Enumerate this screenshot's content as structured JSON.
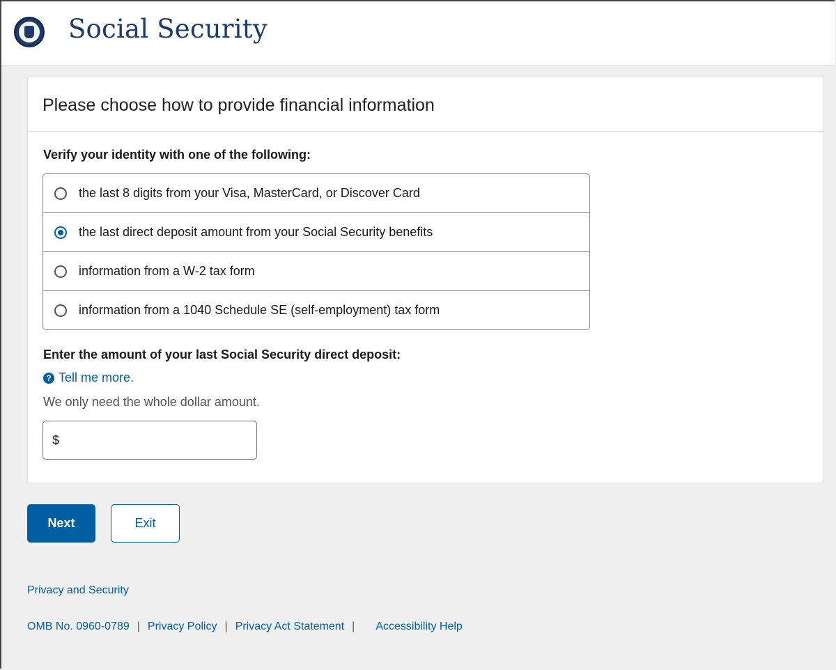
{
  "header": {
    "brand": "Social Security"
  },
  "card": {
    "title": "Please choose how to provide financial information",
    "verify_label": "Verify your identity with one of the following:",
    "options": [
      {
        "label": "the last 8 digits from your Visa, MasterCard, or Discover Card",
        "checked": false
      },
      {
        "label": "the last direct deposit amount from your Social Security benefits",
        "checked": true
      },
      {
        "label": "information from a W-2 tax form",
        "checked": false
      },
      {
        "label": "information from a 1040 Schedule SE (self-employment) tax form",
        "checked": false
      }
    ],
    "amount_label": "Enter the amount of your last Social Security direct deposit:",
    "tell_more": "Tell me more.",
    "hint": "We only need the whole dollar amount.",
    "amount_prefix": "$",
    "amount_value": ""
  },
  "buttons": {
    "next": "Next",
    "exit": "Exit"
  },
  "footer": {
    "privacy_security": "Privacy and Security",
    "omb": "OMB No. 0960-0789",
    "privacy_policy": "Privacy Policy",
    "privacy_act": "Privacy Act Statement",
    "accessibility": "Accessibility Help",
    "separator": "|"
  },
  "colors": {
    "accent": "#005ea2",
    "brand": "#1c3a6b",
    "background": "#efefef"
  }
}
